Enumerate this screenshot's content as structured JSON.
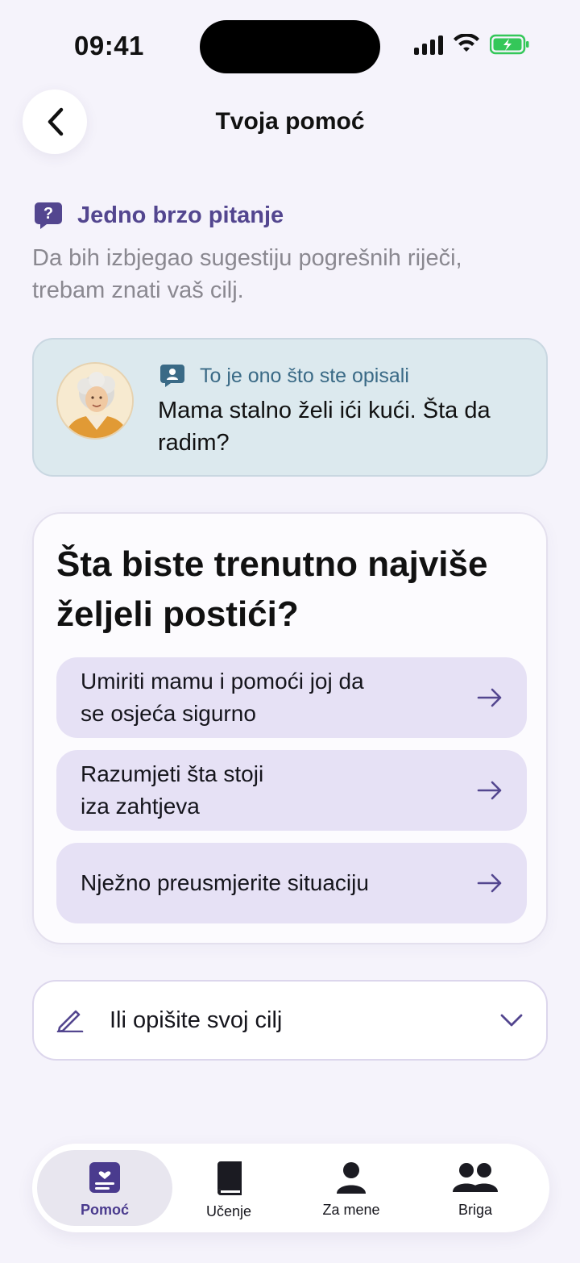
{
  "status": {
    "time": "09:41"
  },
  "header": {
    "title": "Tvoja pomoć"
  },
  "question": {
    "heading": "Jedno brzo pitanje",
    "description": "Da bih izbjegao sugestiju pogrešnih riječi, trebam znati vaš cilj."
  },
  "described": {
    "label": "To je ono što ste opisali",
    "text": "Mama stalno želi ići kući. Šta da radim?"
  },
  "goals": {
    "title": "Šta biste trenutno najviše željeli postići?",
    "options": [
      {
        "label": "Umiriti mamu i pomoći joj da\nse osjeća sigurno"
      },
      {
        "label": "Razumjeti šta stoji\niza zahtjeva"
      },
      {
        "label": "Nježno preusmjerite situaciju"
      }
    ]
  },
  "describe_goal": {
    "label": "Ili opišite svoj cilj"
  },
  "tabbar": {
    "items": [
      {
        "label": "Pomoć",
        "icon": "help-card-icon",
        "active": true
      },
      {
        "label": "Učenje",
        "icon": "book-icon",
        "active": false
      },
      {
        "label": "Za mene",
        "icon": "person-icon",
        "active": false
      },
      {
        "label": "Briga",
        "icon": "people-icon",
        "active": false
      }
    ]
  },
  "colors": {
    "accent": "#53468f",
    "option_bg": "#e6e1f5",
    "described_bg": "#dce9ee",
    "battery": "#34c759"
  }
}
